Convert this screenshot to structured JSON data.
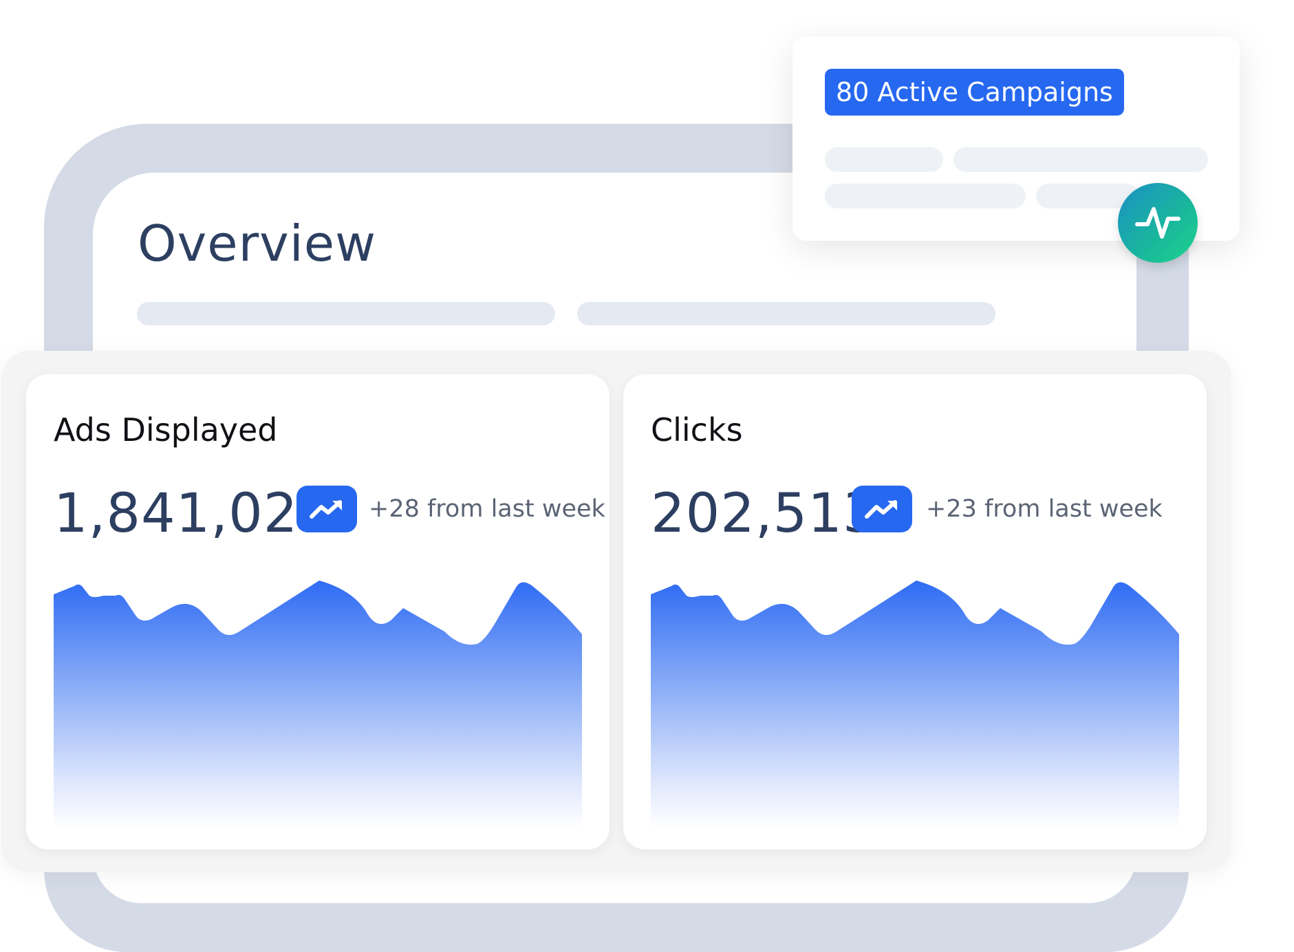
{
  "overview": {
    "title": "Overview"
  },
  "popup": {
    "badge_label": "80 Active Campaigns",
    "pulse_icon": "activity-pulse-icon"
  },
  "cards": [
    {
      "title": "Ads Displayed",
      "value": "1,841,027",
      "trend_icon": "trending-up-icon",
      "change": "+28 from last week"
    },
    {
      "title": "Clicks",
      "value": "202,513",
      "trend_icon": "trending-up-icon",
      "change": "+23 from last week"
    }
  ],
  "colors": {
    "accent": "#2668f0",
    "title_text": "#2d3f61",
    "frame": "#d4dbe7",
    "pulse_start": "#1b8fc5",
    "pulse_end": "#1fd48c"
  }
}
